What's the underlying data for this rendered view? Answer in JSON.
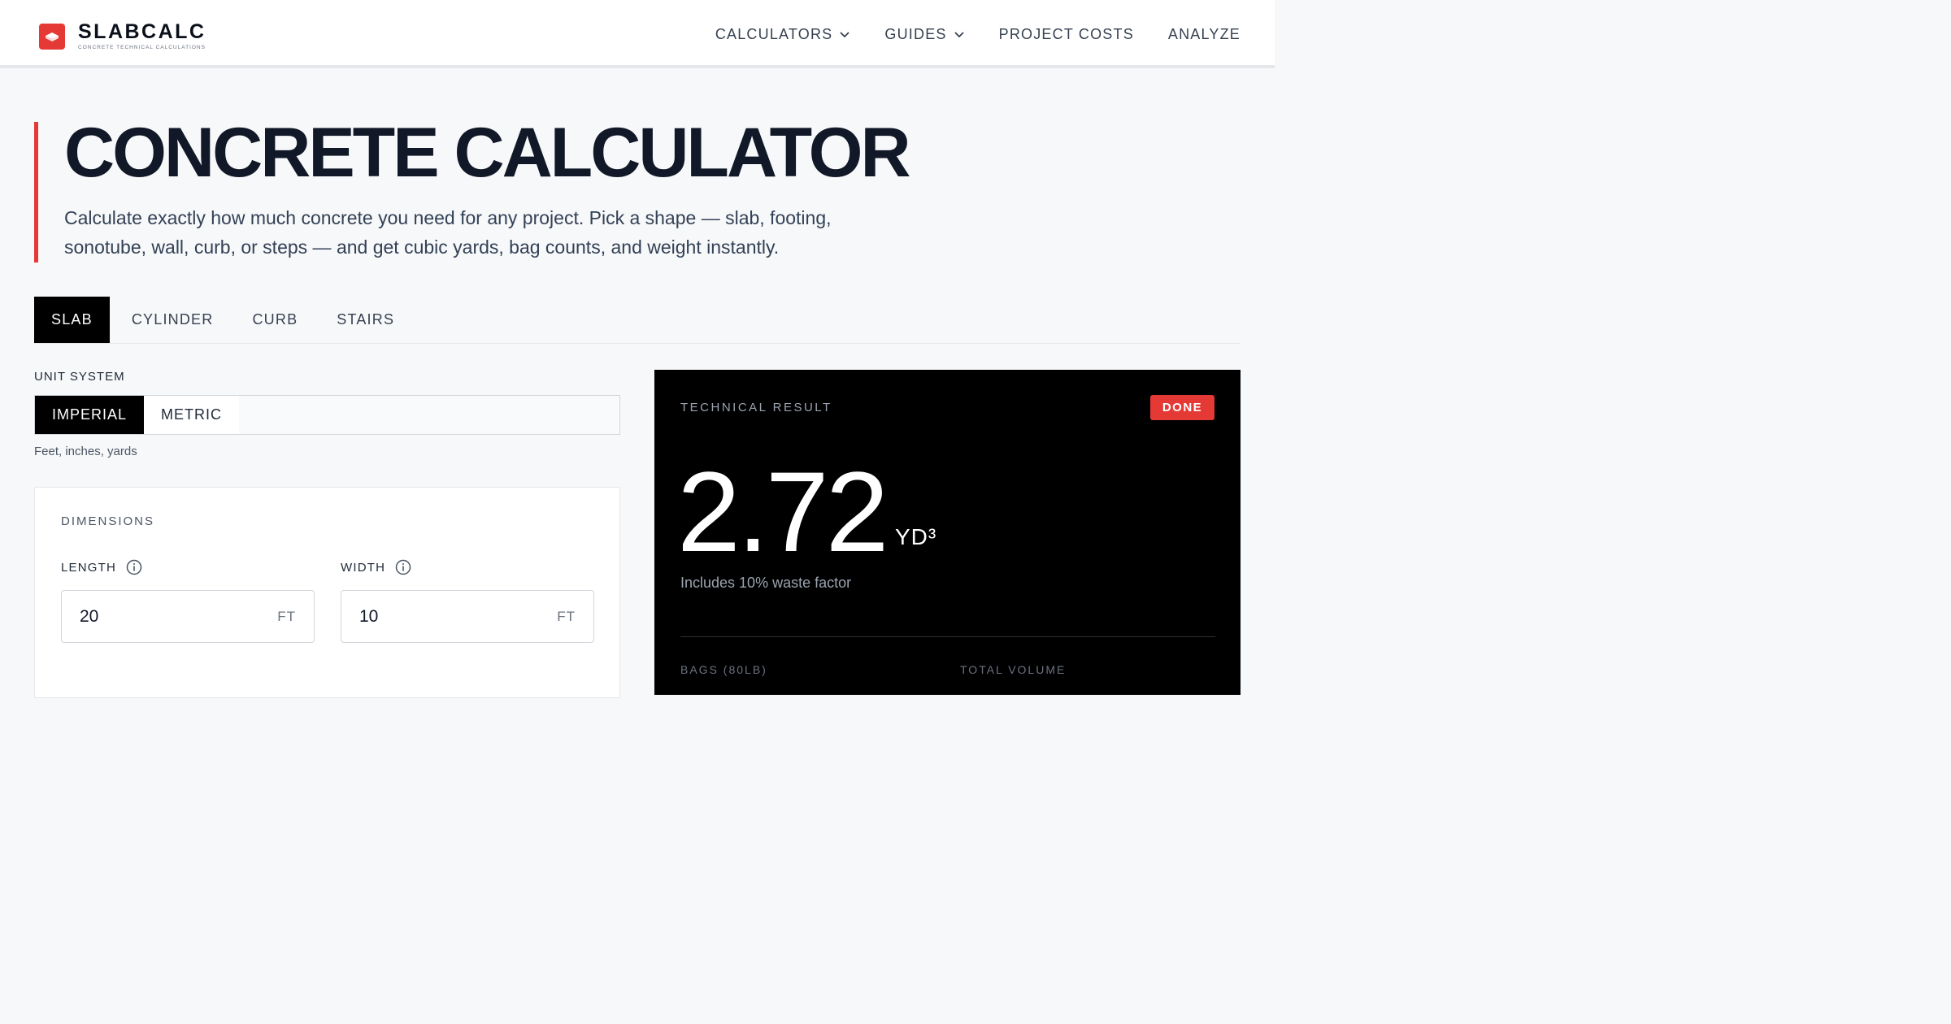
{
  "brand": {
    "name": "SLABCALC",
    "tagline": "CONCRETE TECHNICAL CALCULATIONS",
    "accent_color": "#e53935"
  },
  "nav": {
    "calculators": "CALCULATORS",
    "guides": "GUIDES",
    "project_costs": "PROJECT COSTS",
    "analyze": "ANALYZE"
  },
  "hero": {
    "title": "CONCRETE CALCULATOR",
    "subtitle": "Calculate exactly how much concrete you need for any project. Pick a shape — slab, footing, sonotube, wall, curb, or steps — and get cubic yards, bag counts, and weight instantly."
  },
  "tabs": [
    {
      "label": "SLAB",
      "active": true
    },
    {
      "label": "CYLINDER",
      "active": false
    },
    {
      "label": "CURB",
      "active": false
    },
    {
      "label": "STAIRS",
      "active": false
    }
  ],
  "unit_system": {
    "label": "UNIT SYSTEM",
    "imperial": "IMPERIAL",
    "metric": "METRIC",
    "hint": "Feet, inches, yards"
  },
  "dimensions": {
    "title": "DIMENSIONS",
    "length": {
      "label": "LENGTH",
      "value": "20",
      "unit": "FT"
    },
    "width": {
      "label": "WIDTH",
      "value": "10",
      "unit": "FT"
    }
  },
  "result": {
    "label": "TECHNICAL RESULT",
    "badge": "DONE",
    "value": "2.72",
    "unit": "YD³",
    "note": "Includes 10% waste factor",
    "stat1_label": "BAGS (80LB)",
    "stat2_label": "TOTAL VOLUME"
  }
}
